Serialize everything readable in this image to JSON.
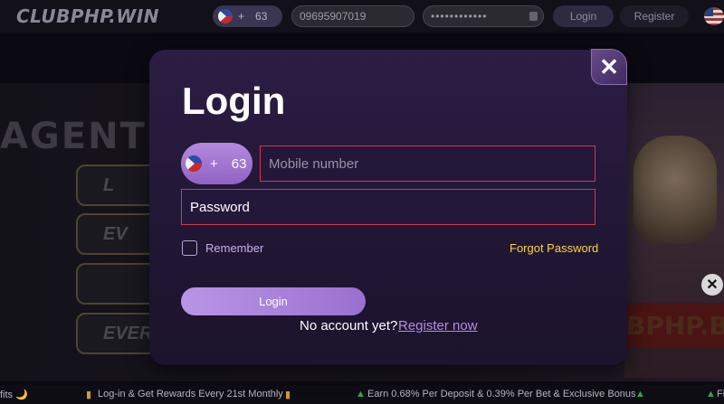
{
  "header": {
    "logo": "CLUBPHP.WIN",
    "country_plus": "+",
    "country_code": "63",
    "mobile_value": "09695907019",
    "password_value": "••••••••••••",
    "login_label": "Login",
    "register_label": "Register",
    "flag_icon": "us-flag-icon"
  },
  "background": {
    "agent_text": "AGENT I",
    "pill_texts": [
      "L",
      "EV",
      "",
      "EVER"
    ],
    "brand_text": "BPHP.B",
    "close_glyph": "✕"
  },
  "modal": {
    "title": "Login",
    "close_glyph": "✕",
    "country_plus": "+",
    "country_code": "63",
    "mobile_placeholder": "Mobile number",
    "password_text": "Password",
    "remember_label": "Remember",
    "forgot_label": "Forgot Password",
    "login_button": "Login",
    "no_account_text": "No account yet?",
    "register_link": "Register now"
  },
  "ticker": {
    "item1_tail": "fits 🌙",
    "item2": "Log-in & Get Rewards Every 21st Monthly",
    "item3": "Earn 0.68% Per Deposit & 0.39% Per Bet & Exclusive Bonus",
    "item4_head": "Fi"
  },
  "colors": {
    "accent": "#9a70d0",
    "field_border": "#d43848",
    "forgot": "#ffd43b",
    "modal_bg": "#2c1d44"
  }
}
